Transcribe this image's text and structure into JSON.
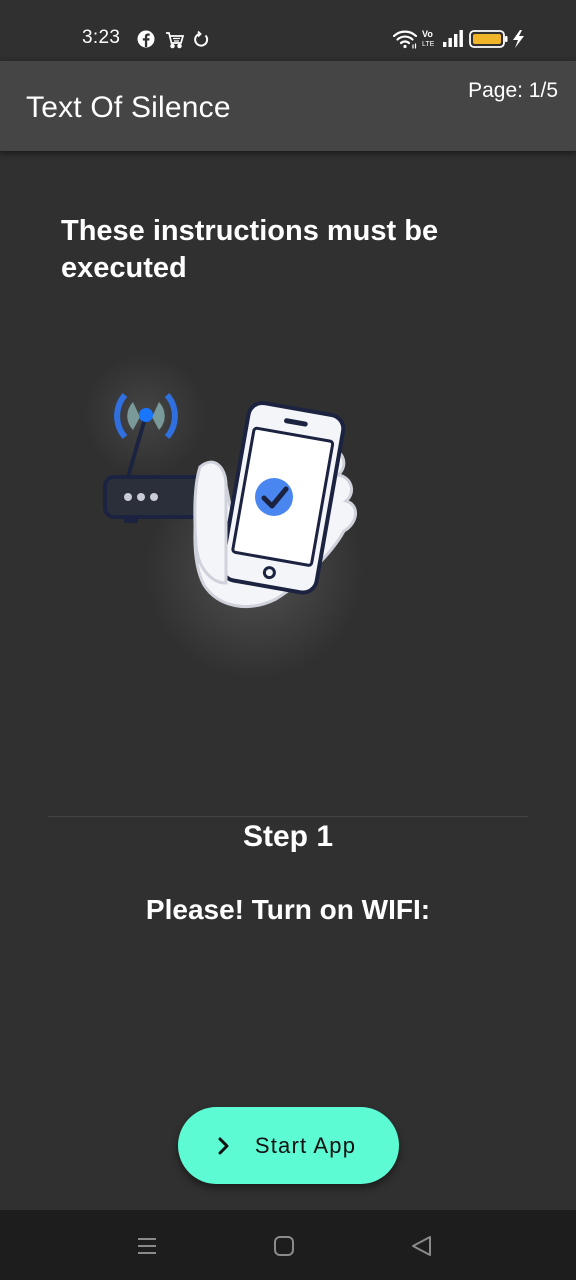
{
  "status_bar": {
    "time": "3:23",
    "left_icons": [
      "facebook-icon",
      "cart-icon",
      "sync-icon"
    ],
    "right_icons": [
      "wifi-icon",
      "volte-icon",
      "signal-icon",
      "battery-icon",
      "charging-icon"
    ]
  },
  "app_bar": {
    "title": "Text Of Silence",
    "page_indicator": "Page: 1/5"
  },
  "content": {
    "heading": "These instructions must be executed",
    "illustration": "wifi-phone-hand-illustration",
    "step_label": "Step 1",
    "step_instruction": "Please! Turn on WIFI:"
  },
  "start_button": {
    "label": "Start App",
    "icon": "chevron-right-icon",
    "color": "#5dfbd3"
  },
  "nav_bar": {
    "buttons": [
      "menu-icon",
      "home-icon",
      "back-icon"
    ]
  },
  "colors": {
    "background": "#303030",
    "app_bar": "#454545",
    "accent": "#5dfbd3",
    "check_blue": "#4a86f0",
    "battery": "#f0b429"
  }
}
